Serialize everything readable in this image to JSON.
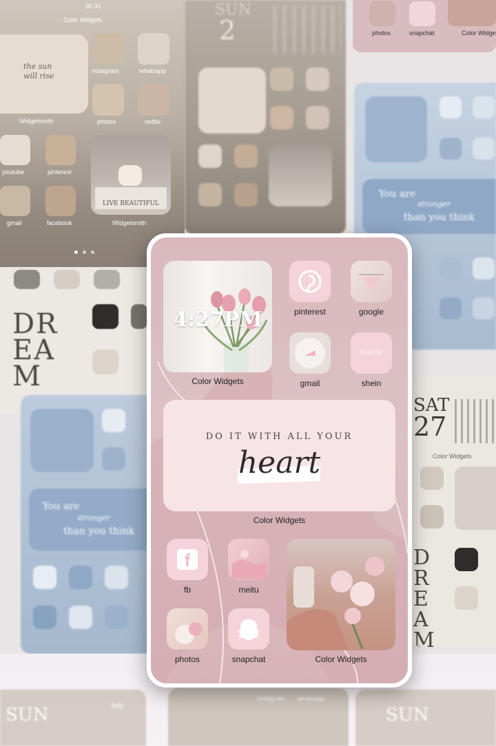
{
  "top_left_card": {
    "dates": "30   31",
    "header_label": "Color Widgets",
    "script_text": "the sun will rise",
    "apps": [
      "instagram",
      "whatsapp",
      "photos",
      "netflix",
      "youtube",
      "pinterest",
      "gmail",
      "facebook"
    ],
    "widget_labels": [
      "Widgetsmith",
      "Widgetsmith"
    ],
    "book_text": "LIVE BEAUTIFUL"
  },
  "top_middle_card": {
    "day": "SUN",
    "date": "2"
  },
  "top_right_card": {
    "apps": [
      "photos",
      "snapchat",
      "Color Widget"
    ]
  },
  "right_blue_card": {
    "quote_line1": "You are",
    "quote_script": "stronger",
    "quote_line2": "than you think"
  },
  "left_beige_card": {
    "letters": "DREAM"
  },
  "left_blue_card": {
    "quote_line1": "You are",
    "quote_script": "stronger",
    "quote_line2": "than you think"
  },
  "right_beige_card": {
    "day": "SAT",
    "date": "27",
    "header_label": "Color Widgets"
  },
  "bottom_strip": {
    "left_day": "SUN",
    "left_month": "July",
    "middle_apps": [
      "instagram",
      "whatsapp"
    ],
    "right_day": "SUN"
  },
  "phone": {
    "clock_widget": {
      "time": "4:27PM",
      "label": "Color Widgets"
    },
    "apps": {
      "pinterest": "pinterest",
      "google": "google",
      "gmail": "gmail",
      "shein": "shein",
      "shein_logo": "SHEIN",
      "fb": "fb",
      "meitu": "meitu",
      "photos": "photos",
      "snapchat": "snapchat"
    },
    "quote_widget": {
      "line1": "DO IT WITH ALL YOUR",
      "script": "heart",
      "label": "Color Widgets"
    },
    "photo_widget": {
      "label": "Color Widgets"
    },
    "colors": {
      "accent_pink": "#e6a9b5",
      "tile_pink": "#f3d3d9",
      "bg_mauve": "#d9b9bd"
    }
  }
}
